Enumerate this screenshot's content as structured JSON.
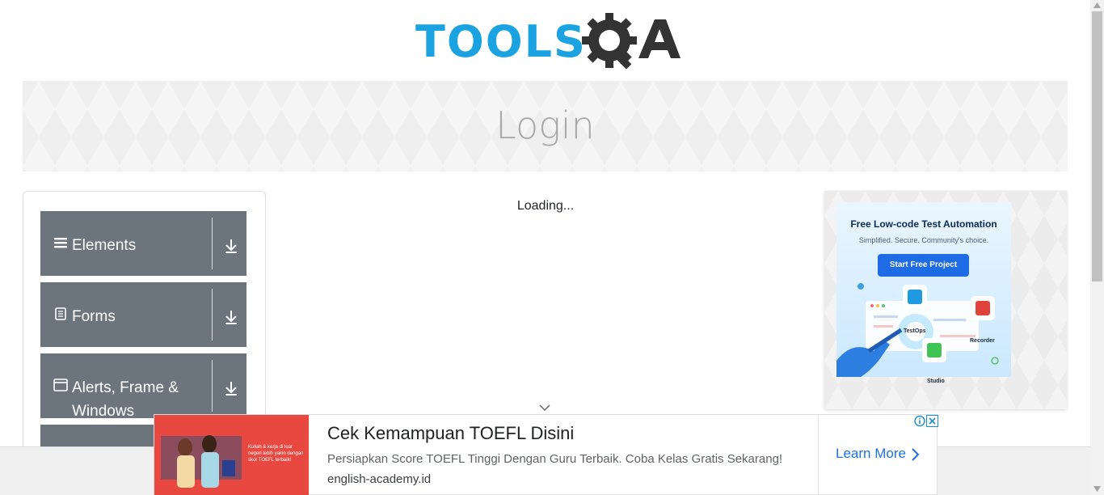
{
  "header": {
    "logo_text": "TOOLS",
    "logo_suffix": "QA"
  },
  "banner": {
    "title": "Login"
  },
  "sidebar": {
    "groups": [
      {
        "label": "Elements",
        "icon": "hamburger-icon"
      },
      {
        "label": "Forms",
        "icon": "document-icon"
      },
      {
        "label": "Alerts, Frame & Windows",
        "icon": "window-icon"
      }
    ]
  },
  "main": {
    "loading_text": "Loading..."
  },
  "right_ad": {
    "title": "Free Low-code Test Automation",
    "subtitle": "Simplified. Secure. Community's choice.",
    "button": "Start Free Project",
    "badges": [
      "TestOps",
      "Recorder",
      "Studio"
    ]
  },
  "bottom_ad": {
    "image_text": "Kuliah & kerja di luar negeri lebih yakin dengan skor TOEFL terbaik!",
    "title": "Cek Kemampuan TOEFL Disini",
    "description": "Persiapkan Score TOEFL Tinggi Dengan Guru Terbaik. Coba Kelas Gratis Sekarang!",
    "url": "english-academy.id",
    "cta": "Learn More"
  },
  "colors": {
    "brand_blue": "#1aa3e0",
    "brand_dark": "#333333",
    "sidebar_group": "#6c757d",
    "cta_blue": "#1a73e8"
  }
}
